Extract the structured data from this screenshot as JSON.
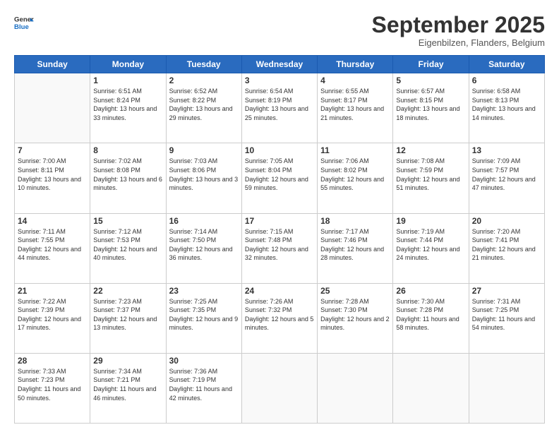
{
  "logo": {
    "line1": "General",
    "line2": "Blue"
  },
  "header": {
    "month": "September 2025",
    "location": "Eigenbilzen, Flanders, Belgium"
  },
  "weekdays": [
    "Sunday",
    "Monday",
    "Tuesday",
    "Wednesday",
    "Thursday",
    "Friday",
    "Saturday"
  ],
  "weeks": [
    [
      {
        "day": "",
        "sunrise": "",
        "sunset": "",
        "daylight": ""
      },
      {
        "day": "1",
        "sunrise": "Sunrise: 6:51 AM",
        "sunset": "Sunset: 8:24 PM",
        "daylight": "Daylight: 13 hours and 33 minutes."
      },
      {
        "day": "2",
        "sunrise": "Sunrise: 6:52 AM",
        "sunset": "Sunset: 8:22 PM",
        "daylight": "Daylight: 13 hours and 29 minutes."
      },
      {
        "day": "3",
        "sunrise": "Sunrise: 6:54 AM",
        "sunset": "Sunset: 8:19 PM",
        "daylight": "Daylight: 13 hours and 25 minutes."
      },
      {
        "day": "4",
        "sunrise": "Sunrise: 6:55 AM",
        "sunset": "Sunset: 8:17 PM",
        "daylight": "Daylight: 13 hours and 21 minutes."
      },
      {
        "day": "5",
        "sunrise": "Sunrise: 6:57 AM",
        "sunset": "Sunset: 8:15 PM",
        "daylight": "Daylight: 13 hours and 18 minutes."
      },
      {
        "day": "6",
        "sunrise": "Sunrise: 6:58 AM",
        "sunset": "Sunset: 8:13 PM",
        "daylight": "Daylight: 13 hours and 14 minutes."
      }
    ],
    [
      {
        "day": "7",
        "sunrise": "Sunrise: 7:00 AM",
        "sunset": "Sunset: 8:11 PM",
        "daylight": "Daylight: 13 hours and 10 minutes."
      },
      {
        "day": "8",
        "sunrise": "Sunrise: 7:02 AM",
        "sunset": "Sunset: 8:08 PM",
        "daylight": "Daylight: 13 hours and 6 minutes."
      },
      {
        "day": "9",
        "sunrise": "Sunrise: 7:03 AM",
        "sunset": "Sunset: 8:06 PM",
        "daylight": "Daylight: 13 hours and 3 minutes."
      },
      {
        "day": "10",
        "sunrise": "Sunrise: 7:05 AM",
        "sunset": "Sunset: 8:04 PM",
        "daylight": "Daylight: 12 hours and 59 minutes."
      },
      {
        "day": "11",
        "sunrise": "Sunrise: 7:06 AM",
        "sunset": "Sunset: 8:02 PM",
        "daylight": "Daylight: 12 hours and 55 minutes."
      },
      {
        "day": "12",
        "sunrise": "Sunrise: 7:08 AM",
        "sunset": "Sunset: 7:59 PM",
        "daylight": "Daylight: 12 hours and 51 minutes."
      },
      {
        "day": "13",
        "sunrise": "Sunrise: 7:09 AM",
        "sunset": "Sunset: 7:57 PM",
        "daylight": "Daylight: 12 hours and 47 minutes."
      }
    ],
    [
      {
        "day": "14",
        "sunrise": "Sunrise: 7:11 AM",
        "sunset": "Sunset: 7:55 PM",
        "daylight": "Daylight: 12 hours and 44 minutes."
      },
      {
        "day": "15",
        "sunrise": "Sunrise: 7:12 AM",
        "sunset": "Sunset: 7:53 PM",
        "daylight": "Daylight: 12 hours and 40 minutes."
      },
      {
        "day": "16",
        "sunrise": "Sunrise: 7:14 AM",
        "sunset": "Sunset: 7:50 PM",
        "daylight": "Daylight: 12 hours and 36 minutes."
      },
      {
        "day": "17",
        "sunrise": "Sunrise: 7:15 AM",
        "sunset": "Sunset: 7:48 PM",
        "daylight": "Daylight: 12 hours and 32 minutes."
      },
      {
        "day": "18",
        "sunrise": "Sunrise: 7:17 AM",
        "sunset": "Sunset: 7:46 PM",
        "daylight": "Daylight: 12 hours and 28 minutes."
      },
      {
        "day": "19",
        "sunrise": "Sunrise: 7:19 AM",
        "sunset": "Sunset: 7:44 PM",
        "daylight": "Daylight: 12 hours and 24 minutes."
      },
      {
        "day": "20",
        "sunrise": "Sunrise: 7:20 AM",
        "sunset": "Sunset: 7:41 PM",
        "daylight": "Daylight: 12 hours and 21 minutes."
      }
    ],
    [
      {
        "day": "21",
        "sunrise": "Sunrise: 7:22 AM",
        "sunset": "Sunset: 7:39 PM",
        "daylight": "Daylight: 12 hours and 17 minutes."
      },
      {
        "day": "22",
        "sunrise": "Sunrise: 7:23 AM",
        "sunset": "Sunset: 7:37 PM",
        "daylight": "Daylight: 12 hours and 13 minutes."
      },
      {
        "day": "23",
        "sunrise": "Sunrise: 7:25 AM",
        "sunset": "Sunset: 7:35 PM",
        "daylight": "Daylight: 12 hours and 9 minutes."
      },
      {
        "day": "24",
        "sunrise": "Sunrise: 7:26 AM",
        "sunset": "Sunset: 7:32 PM",
        "daylight": "Daylight: 12 hours and 5 minutes."
      },
      {
        "day": "25",
        "sunrise": "Sunrise: 7:28 AM",
        "sunset": "Sunset: 7:30 PM",
        "daylight": "Daylight: 12 hours and 2 minutes."
      },
      {
        "day": "26",
        "sunrise": "Sunrise: 7:30 AM",
        "sunset": "Sunset: 7:28 PM",
        "daylight": "Daylight: 11 hours and 58 minutes."
      },
      {
        "day": "27",
        "sunrise": "Sunrise: 7:31 AM",
        "sunset": "Sunset: 7:25 PM",
        "daylight": "Daylight: 11 hours and 54 minutes."
      }
    ],
    [
      {
        "day": "28",
        "sunrise": "Sunrise: 7:33 AM",
        "sunset": "Sunset: 7:23 PM",
        "daylight": "Daylight: 11 hours and 50 minutes."
      },
      {
        "day": "29",
        "sunrise": "Sunrise: 7:34 AM",
        "sunset": "Sunset: 7:21 PM",
        "daylight": "Daylight: 11 hours and 46 minutes."
      },
      {
        "day": "30",
        "sunrise": "Sunrise: 7:36 AM",
        "sunset": "Sunset: 7:19 PM",
        "daylight": "Daylight: 11 hours and 42 minutes."
      },
      {
        "day": "",
        "sunrise": "",
        "sunset": "",
        "daylight": ""
      },
      {
        "day": "",
        "sunrise": "",
        "sunset": "",
        "daylight": ""
      },
      {
        "day": "",
        "sunrise": "",
        "sunset": "",
        "daylight": ""
      },
      {
        "day": "",
        "sunrise": "",
        "sunset": "",
        "daylight": ""
      }
    ]
  ]
}
